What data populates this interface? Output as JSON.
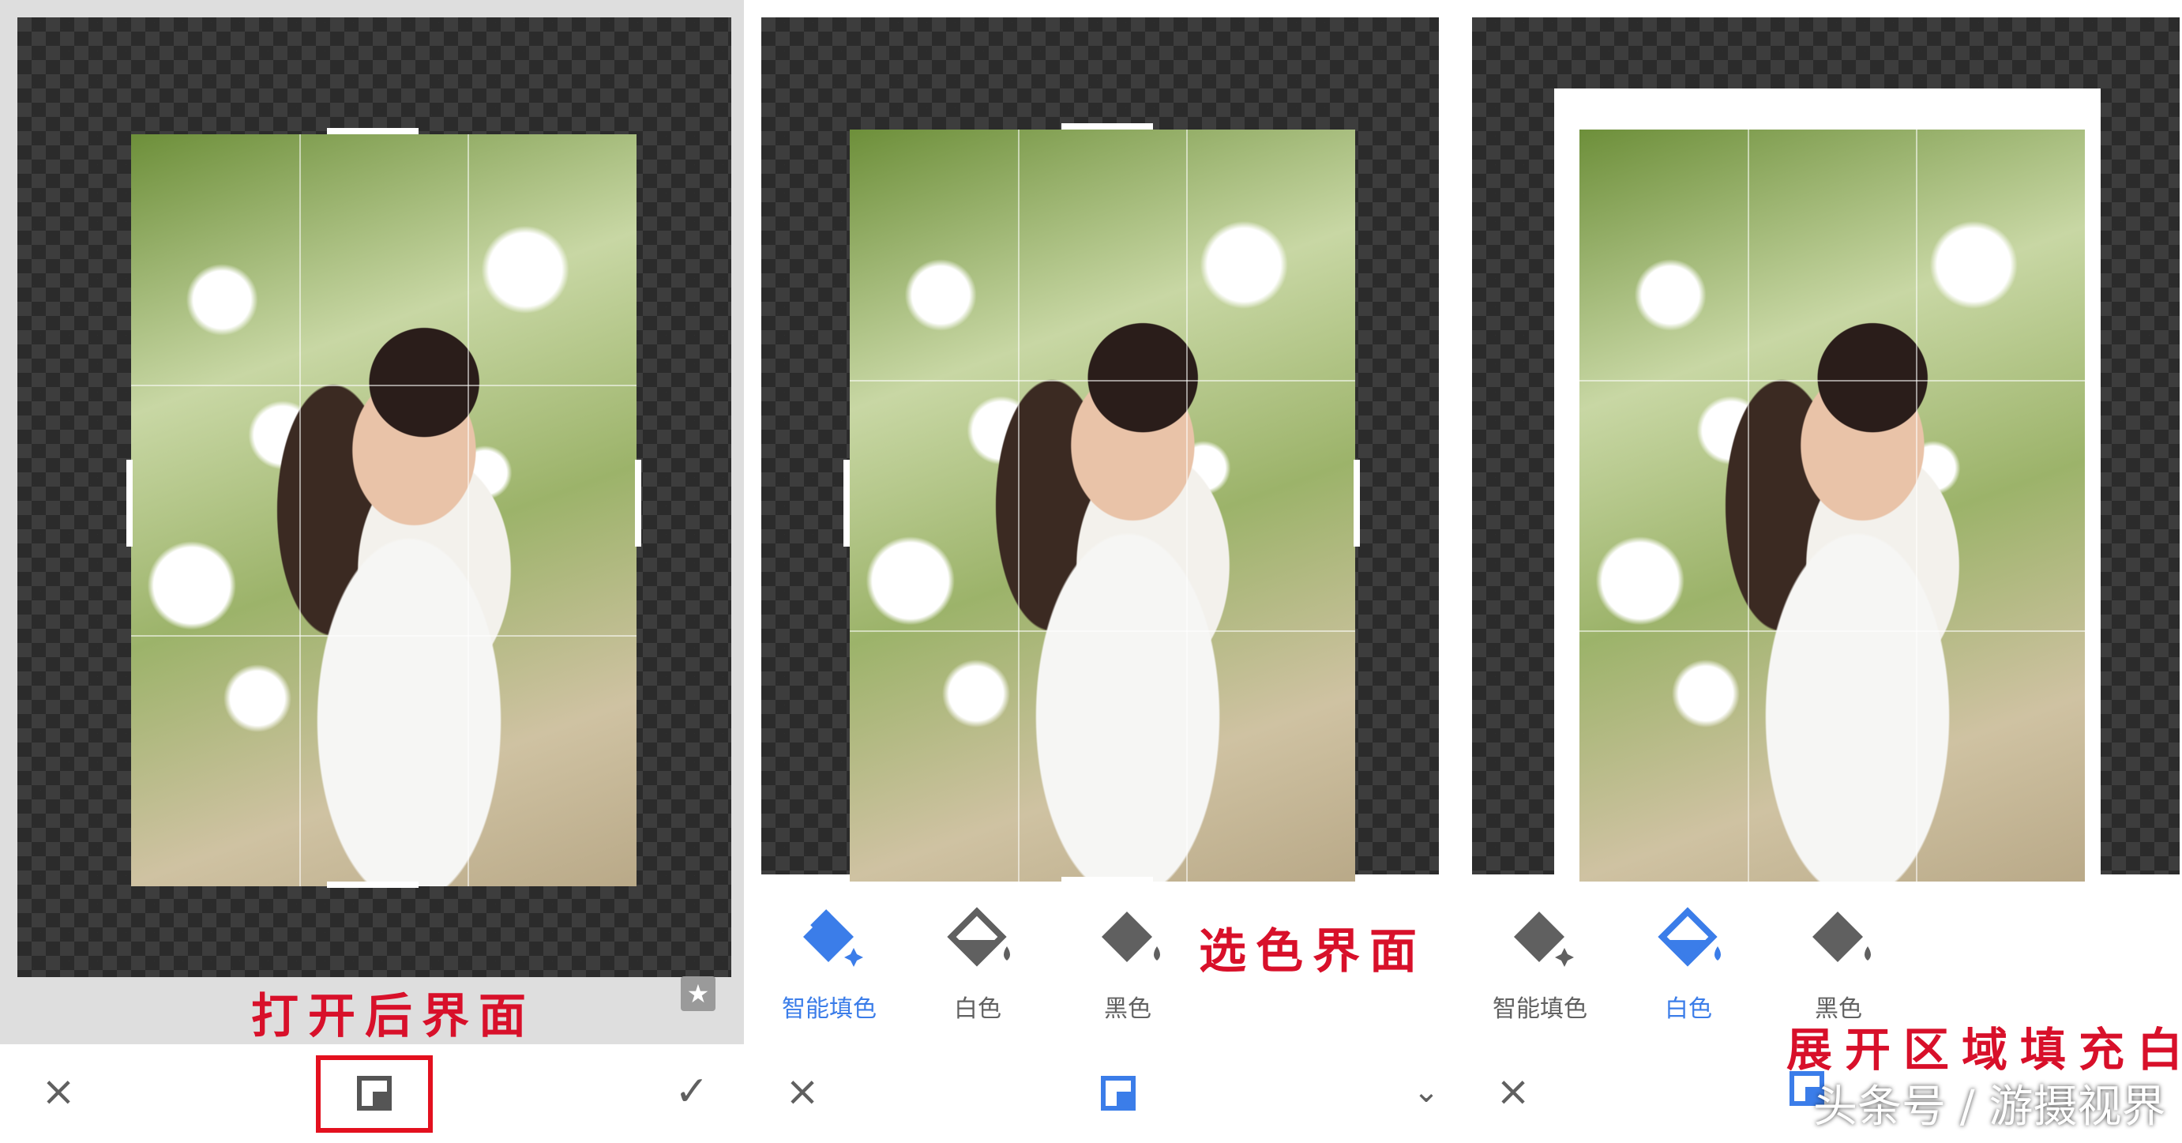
{
  "colors": {
    "accent": "#3b7de9",
    "annotation": "#d8102a",
    "icon_gray": "#606060",
    "highlight_box": "#e3101e"
  },
  "panel1": {
    "annotation": "打开后界面",
    "cancel_icon": "×",
    "confirm_icon": "✓",
    "star_icon": "★"
  },
  "panel2": {
    "annotation": "选色界面",
    "options": [
      {
        "label": "智能填色",
        "icon": "smart-fill-bucket",
        "active": true
      },
      {
        "label": "白色",
        "icon": "white-fill-bucket",
        "active": false
      },
      {
        "label": "黑色",
        "icon": "black-fill-bucket",
        "active": false
      }
    ],
    "cancel_icon": "×",
    "chevron_icon": "⌄"
  },
  "panel3": {
    "annotation": "展开区域填充白",
    "options": [
      {
        "label": "智能填色",
        "icon": "smart-fill-bucket",
        "active": false
      },
      {
        "label": "白色",
        "icon": "white-fill-bucket",
        "active": true
      },
      {
        "label": "黑色",
        "icon": "black-fill-bucket",
        "active": false
      }
    ],
    "cancel_icon": "×"
  },
  "watermark": "头条号 / 游摄视界"
}
